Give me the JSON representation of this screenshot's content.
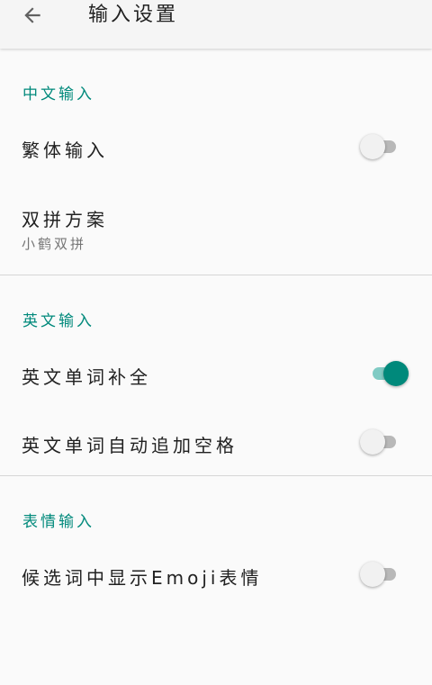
{
  "toolbar": {
    "title": "输入设置",
    "back_icon": "arrow-left-icon"
  },
  "sections": [
    {
      "header": "中文输入",
      "items": [
        {
          "title": "繁体输入",
          "switch_on": false
        },
        {
          "title": "双拼方案",
          "summary": "小鹤双拼"
        }
      ]
    },
    {
      "header": "英文输入",
      "items": [
        {
          "title": "英文单词补全",
          "switch_on": true
        },
        {
          "title": "英文单词自动追加空格",
          "switch_on": false
        }
      ]
    },
    {
      "header": "表情输入",
      "items": [
        {
          "title": "候选词中显示Emoji表情",
          "switch_on": false
        }
      ]
    }
  ],
  "colors": {
    "accent": "#00897b",
    "accent_track": "#80cbc4",
    "switch_off_track": "#b8b8b8",
    "switch_off_thumb": "#f1f1f1",
    "background": "#fafafa"
  }
}
